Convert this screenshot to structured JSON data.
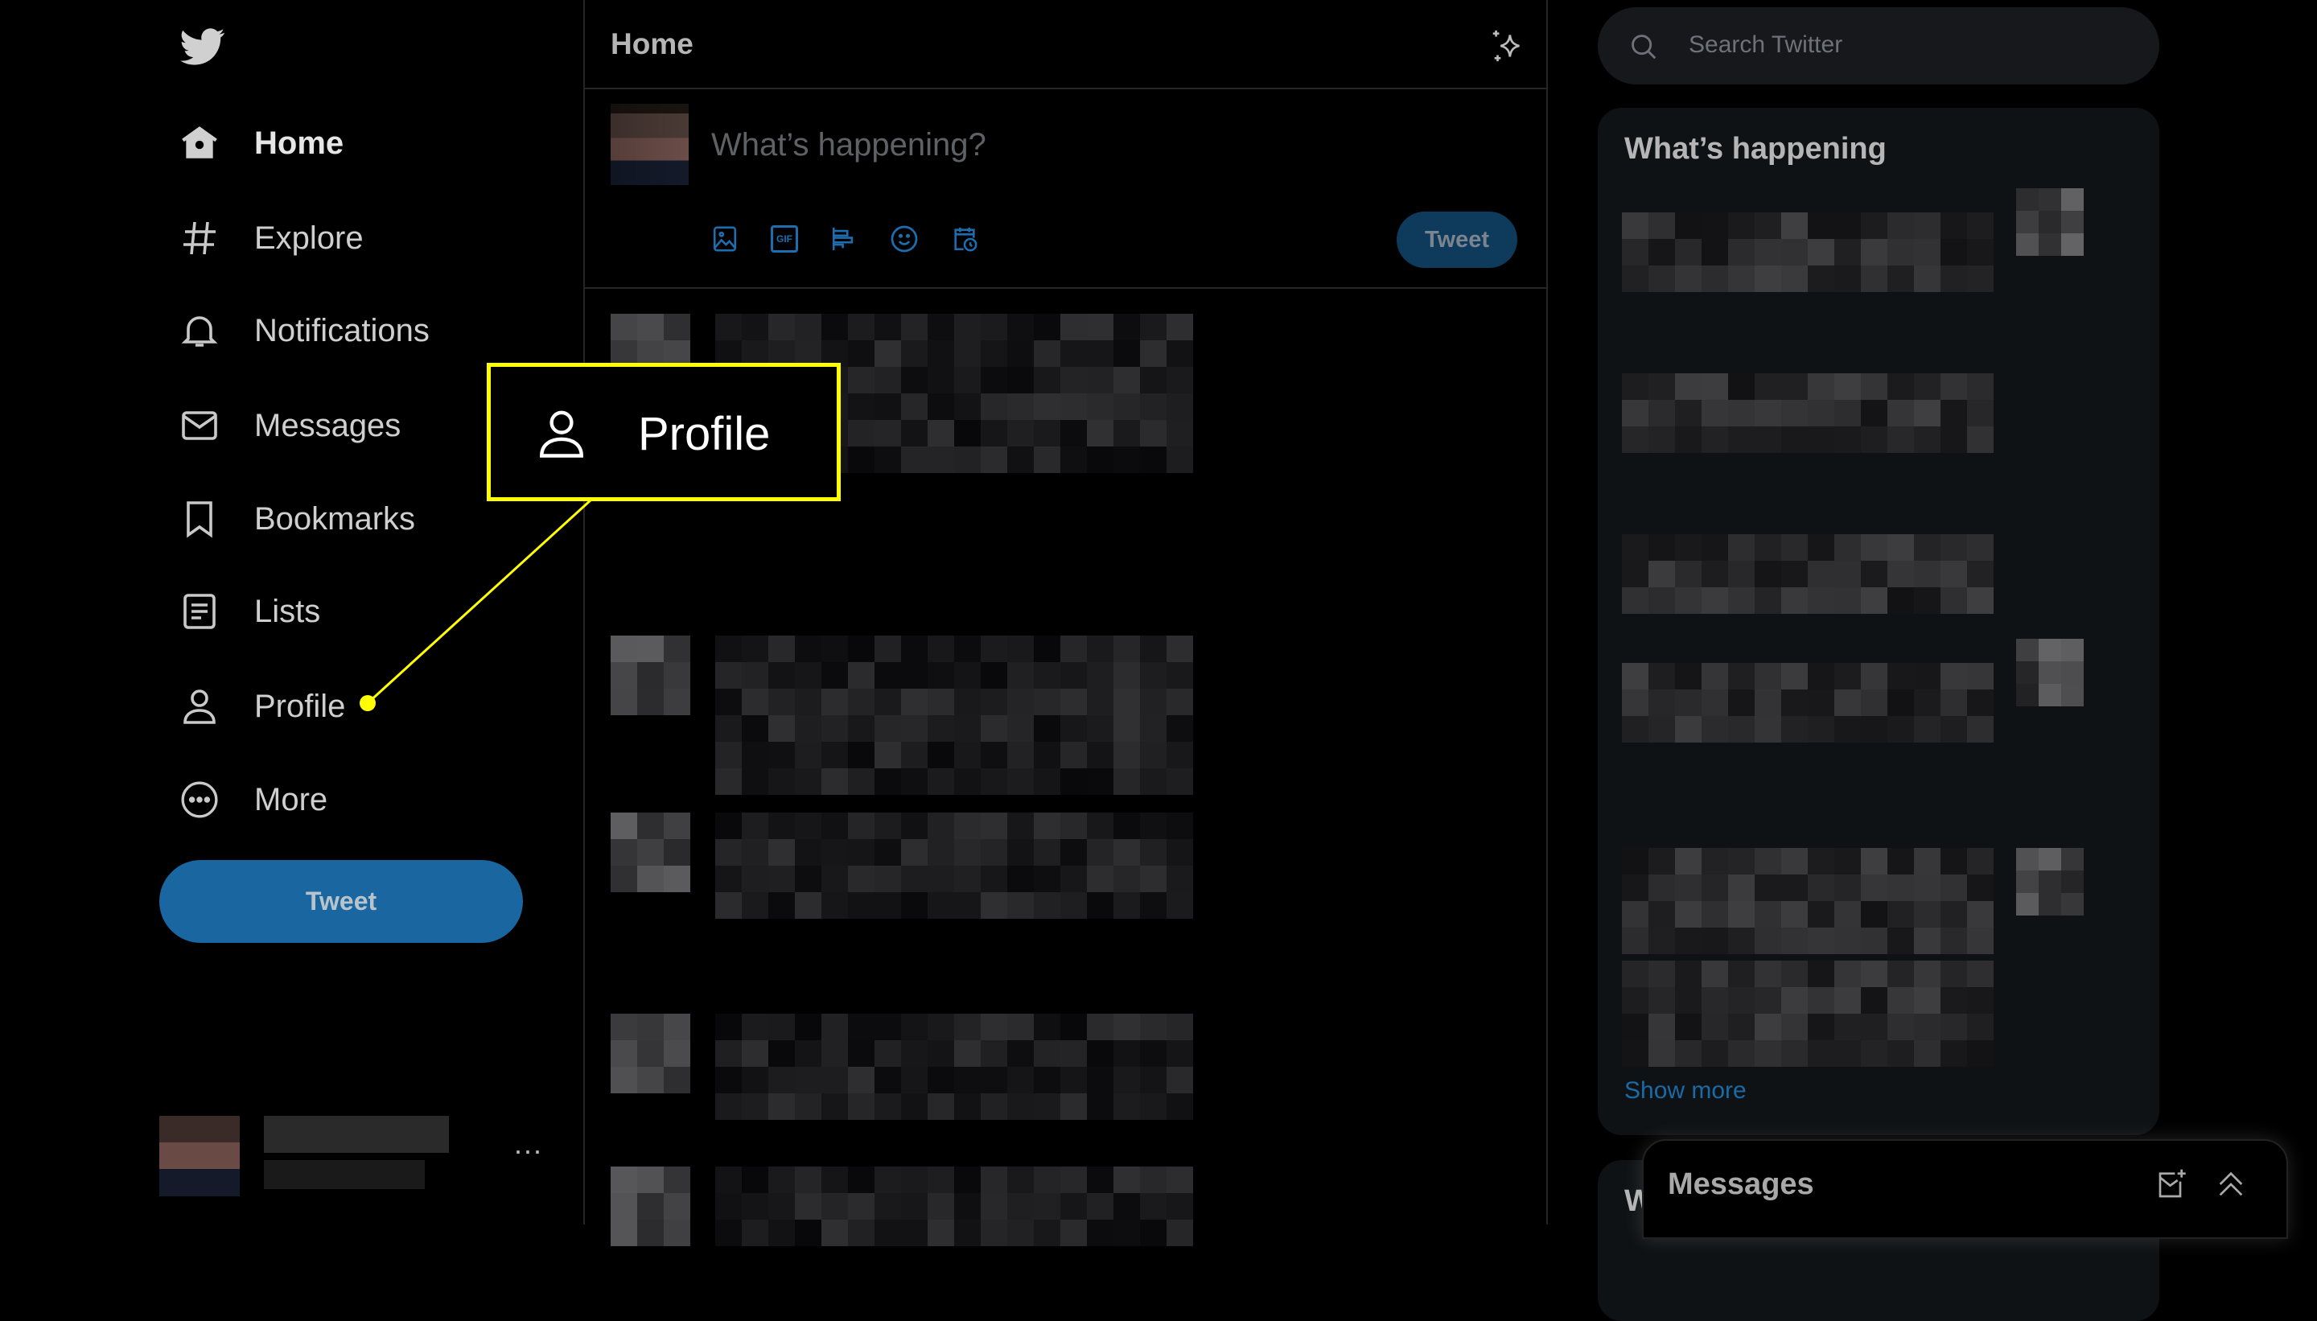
{
  "sidebar": {
    "logo": "twitter-bird-icon",
    "items": [
      {
        "label": "Home",
        "icon": "home-icon",
        "active": true
      },
      {
        "label": "Explore",
        "icon": "hashtag-icon"
      },
      {
        "label": "Notifications",
        "icon": "bell-icon"
      },
      {
        "label": "Messages",
        "icon": "envelope-icon"
      },
      {
        "label": "Bookmarks",
        "icon": "bookmark-icon"
      },
      {
        "label": "Lists",
        "icon": "list-icon"
      },
      {
        "label": "Profile",
        "icon": "person-icon"
      },
      {
        "label": "More",
        "icon": "more-circle-icon"
      }
    ],
    "tweet_button": "Tweet",
    "account_menu": "···"
  },
  "main": {
    "title": "Home",
    "composer": {
      "placeholder": "What’s happening?",
      "tools": [
        "image-icon",
        "gif-icon",
        "poll-icon",
        "emoji-icon",
        "schedule-icon"
      ],
      "gif_label": "GIF",
      "tweet_button": "Tweet"
    }
  },
  "right": {
    "search_placeholder": "Search Twitter",
    "trends_title": "What’s happening",
    "show_more": "Show more",
    "next_card_title": "W"
  },
  "messages_drawer": {
    "title": "Messages"
  },
  "callout": {
    "label": "Profile",
    "icon": "person-icon",
    "color": "#ffff00"
  },
  "colors": {
    "accent": "#1d9bf0",
    "highlight": "#ffff00"
  }
}
